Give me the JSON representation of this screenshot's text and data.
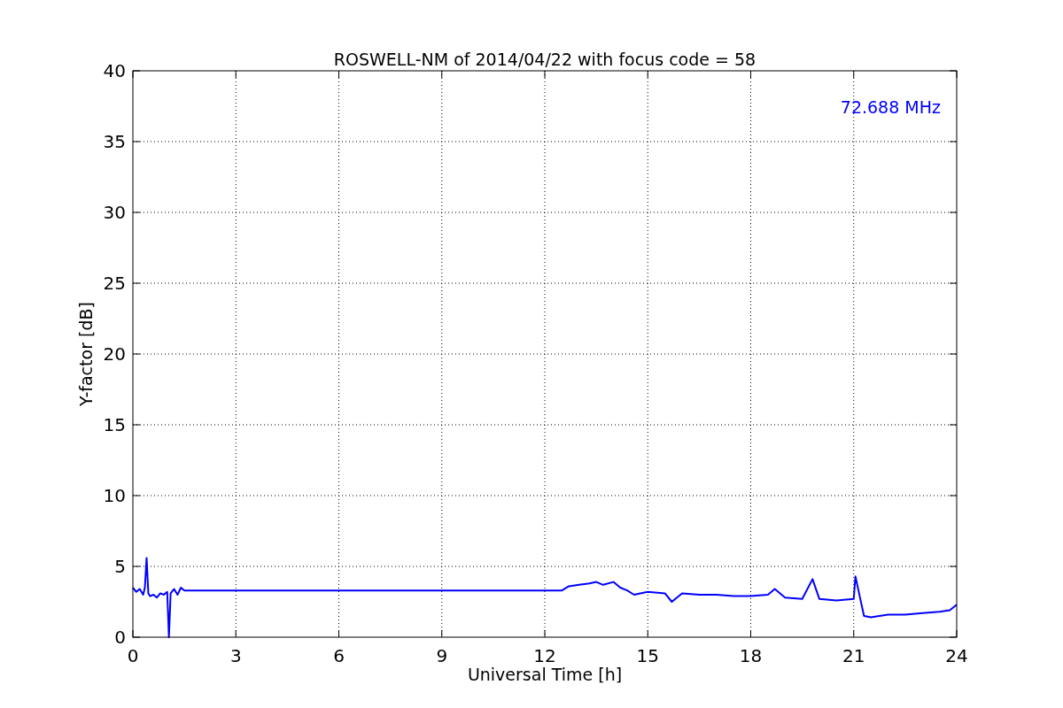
{
  "plot": {
    "chart_data": {
      "type": "line",
      "title": "ROSWELL-NM of 2014/04/22 with focus code = 58",
      "xlabel": "Universal Time [h]",
      "ylabel": "Y-factor [dB]",
      "x": [
        0,
        0.1,
        0.2,
        0.3,
        0.35,
        0.4,
        0.45,
        0.5,
        0.6,
        0.7,
        0.8,
        0.9,
        1.0,
        1.05,
        1.1,
        1.2,
        1.3,
        1.4,
        1.5,
        12.5,
        12.7,
        13.0,
        13.3,
        13.5,
        13.7,
        14.0,
        14.2,
        14.4,
        14.6,
        15.0,
        15.5,
        15.7,
        16.0,
        16.5,
        17.0,
        17.5,
        18.0,
        18.5,
        18.7,
        19.0,
        19.5,
        19.8,
        20.0,
        20.5,
        21.0,
        21.05,
        21.2,
        21.3,
        21.5,
        22.0,
        22.5,
        23.0,
        23.5,
        23.8,
        24
      ],
      "series": [
        {
          "name": "72.688 MHz",
          "color": "#0000ff",
          "values": [
            3.5,
            3.2,
            3.4,
            3.0,
            3.5,
            5.6,
            3.1,
            2.9,
            3.0,
            2.8,
            3.1,
            3.0,
            3.2,
            0,
            3.1,
            3.4,
            3.0,
            3.5,
            3.3,
            3.3,
            3.6,
            3.7,
            3.8,
            3.9,
            3.7,
            3.9,
            3.5,
            3.3,
            3.0,
            3.2,
            3.1,
            2.5,
            3.1,
            3.0,
            3.0,
            2.9,
            2.9,
            3.0,
            3.4,
            2.8,
            2.7,
            4.1,
            2.7,
            2.6,
            2.7,
            4.3,
            2.6,
            1.5,
            1.4,
            1.6,
            1.6,
            1.7,
            1.8,
            1.9,
            2.3
          ]
        }
      ],
      "xlim": [
        0,
        24
      ],
      "ylim": [
        0,
        40
      ],
      "xticks": [
        0,
        3,
        6,
        9,
        12,
        15,
        18,
        21,
        24
      ],
      "yticks": [
        0,
        5,
        10,
        15,
        20,
        25,
        30,
        35,
        40
      ],
      "grid": true
    }
  }
}
